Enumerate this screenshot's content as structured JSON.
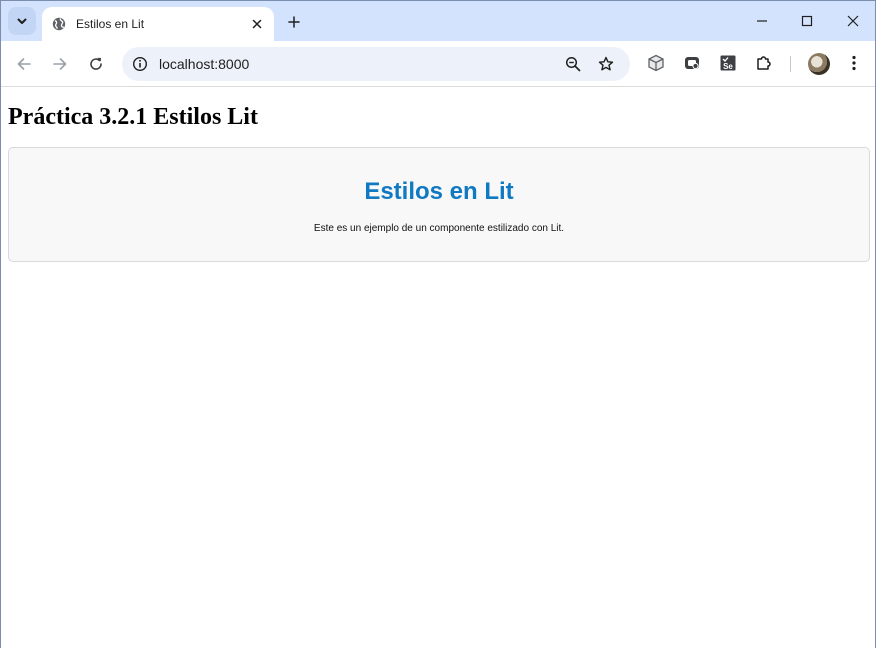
{
  "browser": {
    "tab": {
      "title": "Estilos en Lit"
    },
    "address_bar": {
      "url": "localhost:8000"
    },
    "icons": {
      "tab_search": "chevron-down-icon",
      "favicon": "globe-icon",
      "tab_close": "close-icon",
      "new_tab": "plus-icon",
      "minimize": "minimize-icon",
      "maximize": "maximize-icon",
      "close_window": "close-icon",
      "back": "arrow-left-icon",
      "forward": "arrow-right-icon",
      "reload": "reload-icon",
      "site_info": "info-icon",
      "zoom": "zoom-out-icon",
      "bookmark": "star-icon",
      "extensions": [
        "cube-extension-icon",
        "screen-extension-icon",
        "selenium-extension-icon",
        "puzzle-icon"
      ],
      "profile": "avatar",
      "menu": "kebab-menu-icon"
    },
    "extension_labels": {
      "selenium": "Se"
    }
  },
  "page": {
    "heading": "Práctica 3.2.1 Estilos Lit",
    "card": {
      "title": "Estilos en Lit",
      "text": "Este es un ejemplo de un componente estilizado con Lit."
    }
  },
  "colors": {
    "tabstrip_bg": "#d3e3fd",
    "omnibox_bg": "#edf2fa",
    "card_bg": "#f8f8f8",
    "card_title": "#1079c2"
  }
}
